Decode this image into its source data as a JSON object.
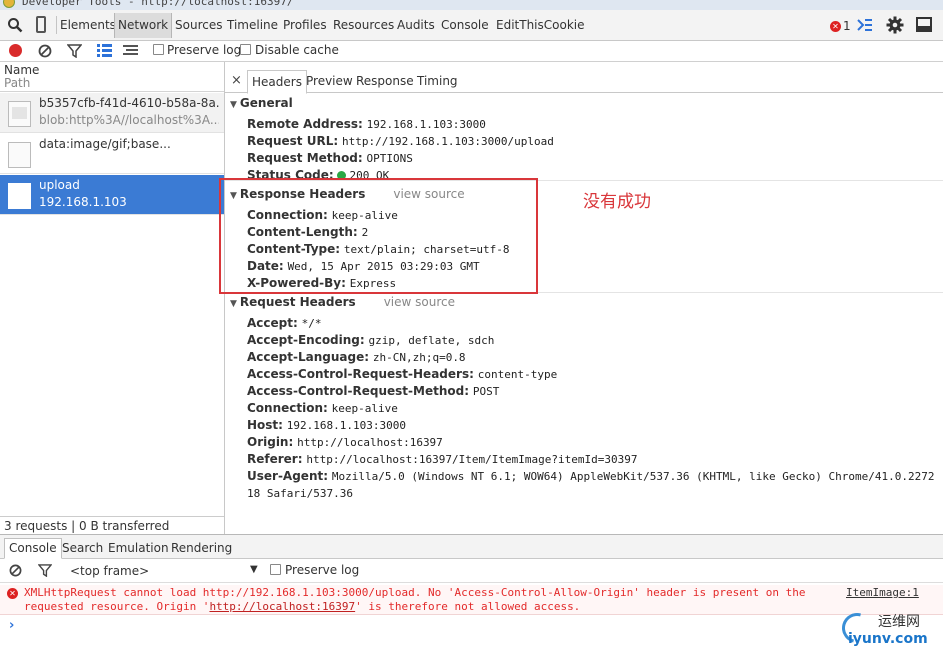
{
  "window": {
    "title": "Developer Tools - http://localhost:16397/"
  },
  "main_toolbar": {
    "tabs": [
      "Elements",
      "Network",
      "Sources",
      "Timeline",
      "Profiles",
      "Resources",
      "Audits",
      "Console",
      "EditThisCookie"
    ],
    "selected": "Network",
    "error_count": "1"
  },
  "network_toolbar": {
    "preserve_log": "Preserve log",
    "disable_cache": "Disable cache"
  },
  "request_list": {
    "header_name": "Name",
    "header_path": "Path",
    "items": [
      {
        "name": "b5357cfb-f41d-4610-b58a-8a...",
        "path": "blob:http%3A//localhost%3A..."
      },
      {
        "name": "data:image/gif;base...",
        "path": ""
      },
      {
        "name": "upload",
        "path": "192.168.1.103"
      }
    ],
    "status": "3 requests  |  0 B transferred"
  },
  "detail": {
    "close_glyph": "×",
    "tabs": [
      "Headers",
      "Preview",
      "Response",
      "Timing"
    ],
    "general": {
      "title": "General",
      "rows": [
        {
          "k": "Remote Address:",
          "v": "192.168.1.103:3000"
        },
        {
          "k": "Request URL:",
          "v": "http://192.168.1.103:3000/upload"
        },
        {
          "k": "Request Method:",
          "v": "OPTIONS"
        },
        {
          "k": "Status Code:",
          "v": "200 OK"
        }
      ]
    },
    "response_headers": {
      "title": "Response Headers",
      "view_source": "view source",
      "rows": [
        {
          "k": "Connection:",
          "v": "keep-alive"
        },
        {
          "k": "Content-Length:",
          "v": "2"
        },
        {
          "k": "Content-Type:",
          "v": "text/plain; charset=utf-8"
        },
        {
          "k": "Date:",
          "v": "Wed, 15 Apr 2015 03:29:03 GMT"
        },
        {
          "k": "X-Powered-By:",
          "v": "Express"
        }
      ]
    },
    "request_headers": {
      "title": "Request Headers",
      "view_source": "view source",
      "rows": [
        {
          "k": "Accept:",
          "v": "*/*"
        },
        {
          "k": "Accept-Encoding:",
          "v": "gzip, deflate, sdch"
        },
        {
          "k": "Accept-Language:",
          "v": "zh-CN,zh;q=0.8"
        },
        {
          "k": "Access-Control-Request-Headers:",
          "v": "content-type"
        },
        {
          "k": "Access-Control-Request-Method:",
          "v": "POST"
        },
        {
          "k": "Connection:",
          "v": "keep-alive"
        },
        {
          "k": "Host:",
          "v": "192.168.1.103:3000"
        },
        {
          "k": "Origin:",
          "v": "http://localhost:16397"
        },
        {
          "k": "Referer:",
          "v": "http://localhost:16397/Item/ItemImage?itemId=30397"
        },
        {
          "k": "User-Agent:",
          "v": "Mozilla/5.0 (Windows NT 6.1; WOW64) AppleWebKit/537.36 (KHTML, like Gecko) Chrome/41.0.2272.1"
        },
        {
          "k": "",
          "v": "18 Safari/537.36"
        }
      ]
    },
    "annotation": "没有成功"
  },
  "drawer": {
    "tabs": [
      "Console",
      "Search",
      "Emulation",
      "Rendering"
    ],
    "context": "<top frame>",
    "caret": "▼",
    "preserve_log": "Preserve log",
    "error": {
      "line1": "XMLHttpRequest cannot load http://192.168.1.103:3000/upload. No 'Access-Control-Allow-Origin' header is present on the",
      "line2_a": "requested resource. Origin '",
      "line2_link": "http://localhost:16397",
      "line2_b": "' is therefore not allowed access.",
      "source": "ItemImage:1"
    },
    "prompt": "›"
  },
  "watermark": {
    "line1": "运维网",
    "line2": "iyunv.com"
  },
  "colors": {
    "accent_selected_row": "#3b7bd4",
    "error_red": "#d22222",
    "annotation_red": "#d9363a"
  }
}
